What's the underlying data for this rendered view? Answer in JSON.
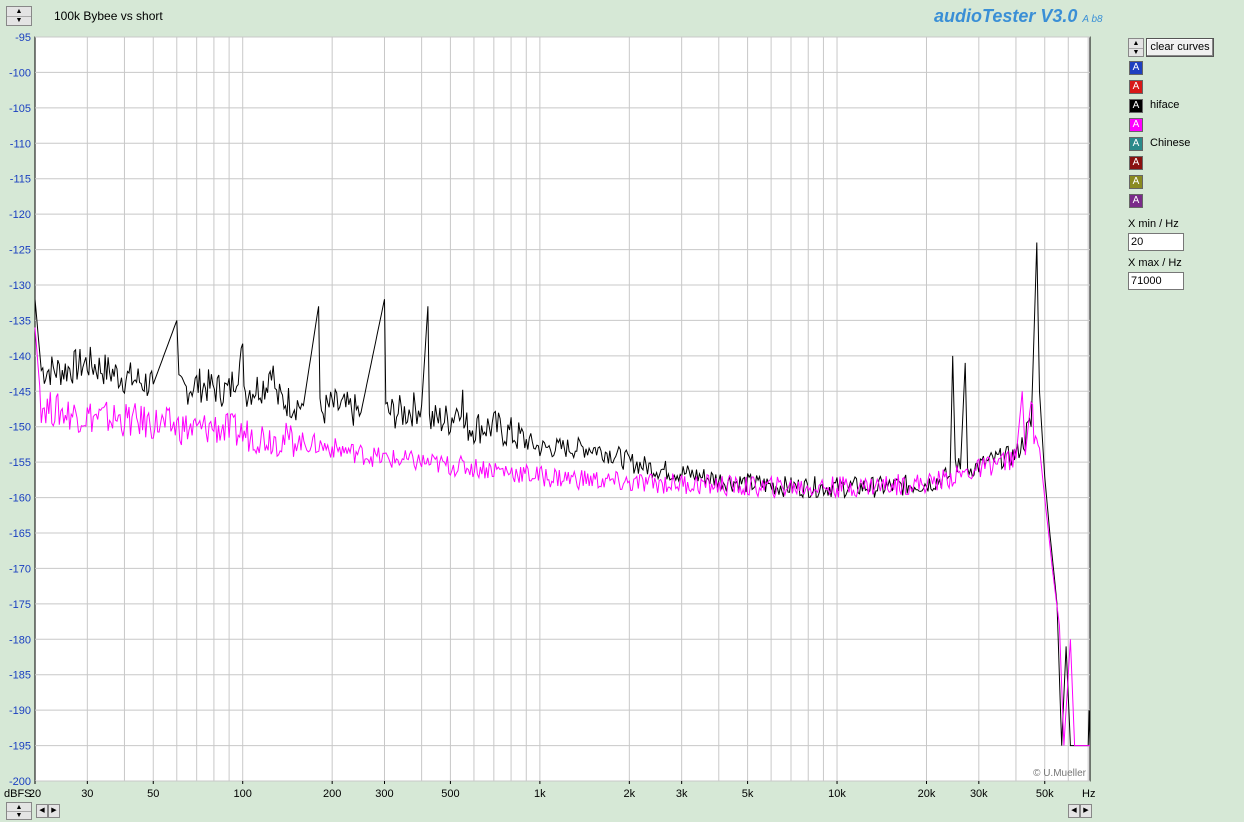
{
  "header": {
    "title": "100k Bybee vs short",
    "brand": "audioTester V3.0",
    "brand_suffix": "A b8"
  },
  "panel": {
    "clear_label": "clear curves",
    "legend": [
      {
        "label": "",
        "color": "#1f3fc0"
      },
      {
        "label": "",
        "color": "#d81818"
      },
      {
        "label": "hiface",
        "color": "#000000"
      },
      {
        "label": "",
        "color": "#ff00ff"
      },
      {
        "label": "Chinese",
        "color": "#2a8a8a"
      },
      {
        "label": "",
        "color": "#8a1010"
      },
      {
        "label": "",
        "color": "#8a8a20"
      },
      {
        "label": "",
        "color": "#7a2a8a"
      }
    ],
    "xmin_label": "X min / Hz",
    "xmin_value": "20",
    "xmax_label": "X max / Hz",
    "xmax_value": "71000",
    "legend_glyph": "A"
  },
  "chart_data": {
    "type": "line",
    "xscale": "log",
    "xlim": [
      20,
      71000
    ],
    "ylim": [
      -200,
      -95
    ],
    "ylabel": "dBFS",
    "xunit": "Hz",
    "watermark": "© U.Mueller",
    "xticks": [
      {
        "v": 20,
        "label": "20"
      },
      {
        "v": 30,
        "label": "30"
      },
      {
        "v": 50,
        "label": "50"
      },
      {
        "v": 100,
        "label": "100"
      },
      {
        "v": 200,
        "label": "200"
      },
      {
        "v": 300,
        "label": "300"
      },
      {
        "v": 500,
        "label": "500"
      },
      {
        "v": 1000,
        "label": "1k"
      },
      {
        "v": 2000,
        "label": "2k"
      },
      {
        "v": 3000,
        "label": "3k"
      },
      {
        "v": 5000,
        "label": "5k"
      },
      {
        "v": 10000,
        "label": "10k"
      },
      {
        "v": 20000,
        "label": "20k"
      },
      {
        "v": 30000,
        "label": "30k"
      },
      {
        "v": 50000,
        "label": "50k"
      }
    ],
    "yticks": [
      -95,
      -100,
      -105,
      -110,
      -115,
      -120,
      -125,
      -130,
      -135,
      -140,
      -145,
      -150,
      -155,
      -160,
      -165,
      -170,
      -175,
      -180,
      -185,
      -190,
      -195,
      -200
    ],
    "series": [
      {
        "name": "hiface",
        "color": "#000000",
        "points": [
          [
            20,
            -132
          ],
          [
            21,
            -142
          ],
          [
            25,
            -142
          ],
          [
            30,
            -141
          ],
          [
            40,
            -143
          ],
          [
            50,
            -144
          ],
          [
            60,
            -135
          ],
          [
            61,
            -145
          ],
          [
            70,
            -144
          ],
          [
            90,
            -145
          ],
          [
            100,
            -140
          ],
          [
            102,
            -145
          ],
          [
            120,
            -144
          ],
          [
            125,
            -141
          ],
          [
            130,
            -146
          ],
          [
            160,
            -147
          ],
          [
            180,
            -133
          ],
          [
            182,
            -148
          ],
          [
            200,
            -147
          ],
          [
            250,
            -148
          ],
          [
            300,
            -132
          ],
          [
            303,
            -148
          ],
          [
            350,
            -148
          ],
          [
            400,
            -147
          ],
          [
            420,
            -133
          ],
          [
            425,
            -149
          ],
          [
            500,
            -149
          ],
          [
            550,
            -146
          ],
          [
            555,
            -150
          ],
          [
            600,
            -150
          ],
          [
            700,
            -150
          ],
          [
            800,
            -151
          ],
          [
            900,
            -152
          ],
          [
            1000,
            -153
          ],
          [
            1100,
            -153
          ],
          [
            1300,
            -153
          ],
          [
            1500,
            -153
          ],
          [
            1800,
            -154
          ],
          [
            2000,
            -155
          ],
          [
            2500,
            -156
          ],
          [
            3000,
            -156.5
          ],
          [
            4000,
            -157.5
          ],
          [
            5000,
            -158
          ],
          [
            7000,
            -158.5
          ],
          [
            10000,
            -158.5
          ],
          [
            15000,
            -158.5
          ],
          [
            20000,
            -158
          ],
          [
            24000,
            -157
          ],
          [
            24500,
            -140
          ],
          [
            25000,
            -155
          ],
          [
            26000,
            -156
          ],
          [
            27000,
            -141
          ],
          [
            27500,
            -156
          ],
          [
            30000,
            -155.5
          ],
          [
            35000,
            -154.5
          ],
          [
            40000,
            -154
          ],
          [
            45000,
            -150
          ],
          [
            47000,
            -124
          ],
          [
            48000,
            -145
          ],
          [
            50000,
            -157
          ],
          [
            52000,
            -165
          ],
          [
            55000,
            -175
          ],
          [
            57000,
            -195
          ],
          [
            59000,
            -181
          ],
          [
            61000,
            -195
          ],
          [
            65000,
            -195
          ],
          [
            70000,
            -195
          ],
          [
            70500,
            -190
          ],
          [
            71000,
            -195
          ]
        ]
      },
      {
        "name": "",
        "color": "#ff00ff",
        "points": [
          [
            20,
            -136
          ],
          [
            21,
            -147
          ],
          [
            25,
            -148
          ],
          [
            30,
            -148.5
          ],
          [
            40,
            -149
          ],
          [
            50,
            -149.5
          ],
          [
            60,
            -150
          ],
          [
            70,
            -150.5
          ],
          [
            80,
            -150
          ],
          [
            100,
            -151
          ],
          [
            150,
            -152
          ],
          [
            200,
            -153
          ],
          [
            300,
            -154.5
          ],
          [
            400,
            -155
          ],
          [
            500,
            -155.5
          ],
          [
            700,
            -156
          ],
          [
            1000,
            -157
          ],
          [
            1500,
            -157.5
          ],
          [
            2000,
            -158
          ],
          [
            3000,
            -158
          ],
          [
            5000,
            -158.5
          ],
          [
            10000,
            -158.5
          ],
          [
            20000,
            -158
          ],
          [
            25000,
            -157
          ],
          [
            30000,
            -156
          ],
          [
            35000,
            -155
          ],
          [
            40000,
            -154.5
          ],
          [
            42000,
            -145
          ],
          [
            43000,
            -154
          ],
          [
            45000,
            -146
          ],
          [
            46000,
            -152
          ],
          [
            48000,
            -153
          ],
          [
            50000,
            -160
          ],
          [
            53000,
            -170
          ],
          [
            56000,
            -178
          ],
          [
            58000,
            -195
          ],
          [
            61000,
            -180
          ],
          [
            63000,
            -195
          ],
          [
            71000,
            -195
          ]
        ]
      }
    ]
  }
}
